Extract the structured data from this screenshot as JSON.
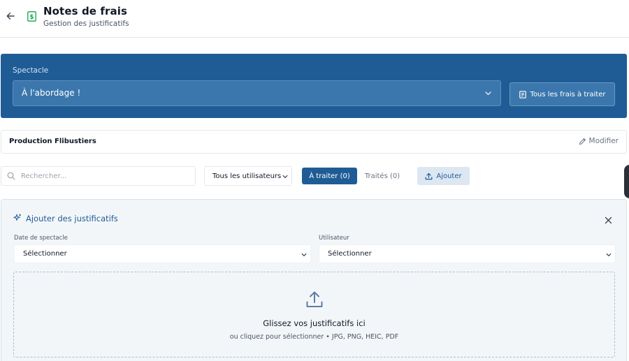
{
  "header": {
    "title": "Notes de frais",
    "subtitle": "Gestion des justificatifs",
    "back_icon": "arrow-left-icon",
    "doc_icon": "receipt-icon"
  },
  "spectacle_panel": {
    "label": "Spectacle",
    "selected": "À l'abordage !",
    "all_fees_button": "Tous les frais à traiter",
    "background_color": "#1f5c96"
  },
  "production": {
    "name": "Production Flibustiers",
    "modify_label": "Modifier"
  },
  "toolbar": {
    "search_placeholder": "Rechercher...",
    "user_filter": "Tous les utilisateurs",
    "tab_pending": "À traiter (0)",
    "tab_done": "Traités (0)",
    "add_label": "Ajouter"
  },
  "add_panel": {
    "title": "Ajouter des justificatifs",
    "date_label": "Date de spectacle",
    "date_value": "Sélectionner",
    "user_label": "Utilisateur",
    "user_value": "Sélectionner",
    "drop_title": "Glissez vos justificatifs ici",
    "drop_subtitle": "ou cliquez pour sélectionner • JPG, PNG, HEIC, PDF"
  },
  "colors": {
    "accent": "#1f5c96",
    "doc_icon": "#16a34a"
  }
}
